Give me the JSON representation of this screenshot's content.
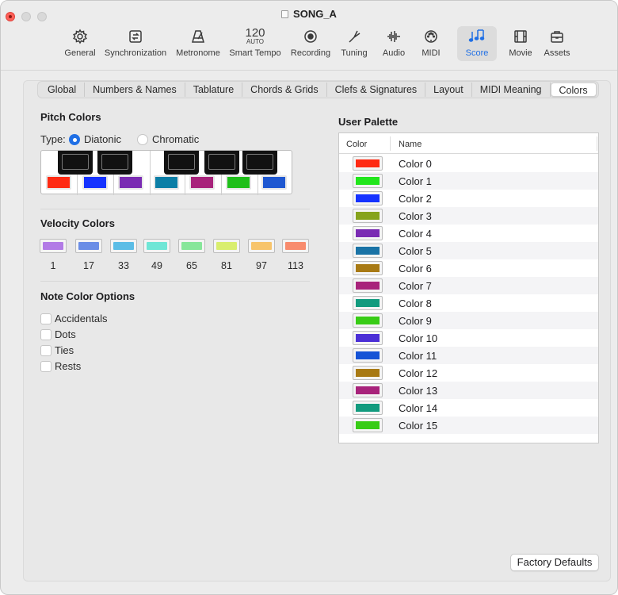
{
  "window": {
    "title": "SONG_A"
  },
  "toolbar": {
    "items": [
      {
        "label": "General",
        "icon": "gear-icon"
      },
      {
        "label": "Synchronization",
        "icon": "sync-icon"
      },
      {
        "label": "Metronome",
        "icon": "metronome-icon"
      },
      {
        "label": "Smart Tempo",
        "icon": "tempo-icon",
        "tempo_value": "120",
        "tempo_mode": "AUTO"
      },
      {
        "label": "Recording",
        "icon": "record-icon"
      },
      {
        "label": "Tuning",
        "icon": "tuning-fork-icon"
      },
      {
        "label": "Audio",
        "icon": "waveform-icon"
      },
      {
        "label": "MIDI",
        "icon": "midi-icon"
      },
      {
        "label": "Score",
        "icon": "score-notes-icon",
        "active": true
      },
      {
        "label": "Movie",
        "icon": "film-icon"
      },
      {
        "label": "Assets",
        "icon": "briefcase-icon"
      }
    ]
  },
  "tabs": [
    "Global",
    "Numbers & Names",
    "Tablature",
    "Chords & Grids",
    "Clefs & Signatures",
    "Layout",
    "MIDI Meaning",
    "Colors"
  ],
  "selected_tab": "Colors",
  "pitch_colors": {
    "title": "Pitch Colors",
    "type_label": "Type:",
    "options": [
      "Diatonic",
      "Chromatic"
    ],
    "selected": "Diatonic",
    "swatches": [
      "#ff2a12",
      "#1532ff",
      "#7a2bb3",
      "#0b7ea6",
      "#a8237b",
      "#1fbf1a",
      "#1f58d1"
    ]
  },
  "velocity_colors": {
    "title": "Velocity Colors",
    "items": [
      {
        "value": "1",
        "color": "#b27be6"
      },
      {
        "value": "17",
        "color": "#6a8de6"
      },
      {
        "value": "33",
        "color": "#5cbde6"
      },
      {
        "value": "49",
        "color": "#6fe6d6"
      },
      {
        "value": "65",
        "color": "#87e69a"
      },
      {
        "value": "81",
        "color": "#d9ee6e"
      },
      {
        "value": "97",
        "color": "#f7c46b"
      },
      {
        "value": "113",
        "color": "#f88c6e"
      }
    ]
  },
  "note_color_options": {
    "title": "Note Color Options",
    "options": [
      "Accidentals",
      "Dots",
      "Ties",
      "Rests"
    ]
  },
  "user_palette": {
    "title": "User Palette",
    "col_color": "Color",
    "col_name": "Name",
    "rows": [
      {
        "name": "Color 0",
        "color": "#ff2a12"
      },
      {
        "name": "Color 1",
        "color": "#22e61c"
      },
      {
        "name": "Color 2",
        "color": "#1532ff"
      },
      {
        "name": "Color 3",
        "color": "#86a31c"
      },
      {
        "name": "Color 4",
        "color": "#7a2bb3"
      },
      {
        "name": "Color 5",
        "color": "#1a73a6"
      },
      {
        "name": "Color 6",
        "color": "#a87a14"
      },
      {
        "name": "Color 7",
        "color": "#a8237b"
      },
      {
        "name": "Color 8",
        "color": "#129b7e"
      },
      {
        "name": "Color 9",
        "color": "#38cc16"
      },
      {
        "name": "Color 10",
        "color": "#4b2fd6"
      },
      {
        "name": "Color 11",
        "color": "#1553d6"
      },
      {
        "name": "Color 12",
        "color": "#a87a14"
      },
      {
        "name": "Color 13",
        "color": "#a8237b"
      },
      {
        "name": "Color 14",
        "color": "#129b7e"
      },
      {
        "name": "Color 15",
        "color": "#38cc16"
      }
    ]
  },
  "factory_defaults_label": "Factory Defaults"
}
